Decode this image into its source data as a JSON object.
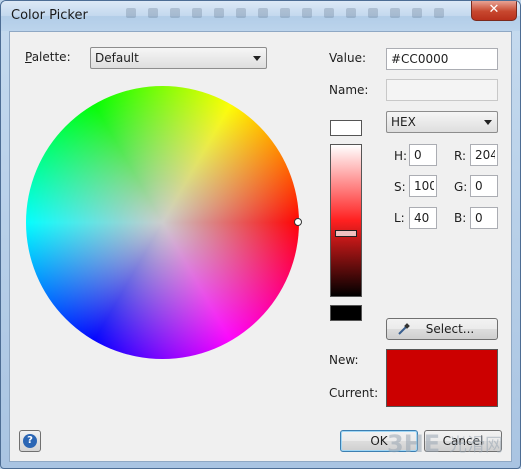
{
  "window": {
    "title": "Color Picker",
    "close_glyph": "✕"
  },
  "palette": {
    "label": "Palette:",
    "selected": "Default"
  },
  "value": {
    "label": "Value:",
    "text": "#CC0000"
  },
  "name": {
    "label": "Name:",
    "text": ""
  },
  "format": {
    "selected": "HEX"
  },
  "hsl": {
    "h_label": "H:",
    "h": "0",
    "s_label": "S:",
    "s": "100",
    "l_label": "L:",
    "l": "40"
  },
  "rgb": {
    "r_label": "R:",
    "r": "204",
    "g_label": "G:",
    "g": "0",
    "b_label": "B:",
    "b": "0"
  },
  "select_button": {
    "label": "Select...",
    "icon": "eyedropper-icon"
  },
  "new_color": {
    "label": "New:",
    "hex": "#CC0000"
  },
  "current_color": {
    "label": "Current:",
    "hex": "#CC0000"
  },
  "buttons": {
    "ok": "OK",
    "cancel": "Cancel",
    "help": "?"
  },
  "luminance_level": 0.4,
  "watermark": {
    "text": "光滑网"
  }
}
